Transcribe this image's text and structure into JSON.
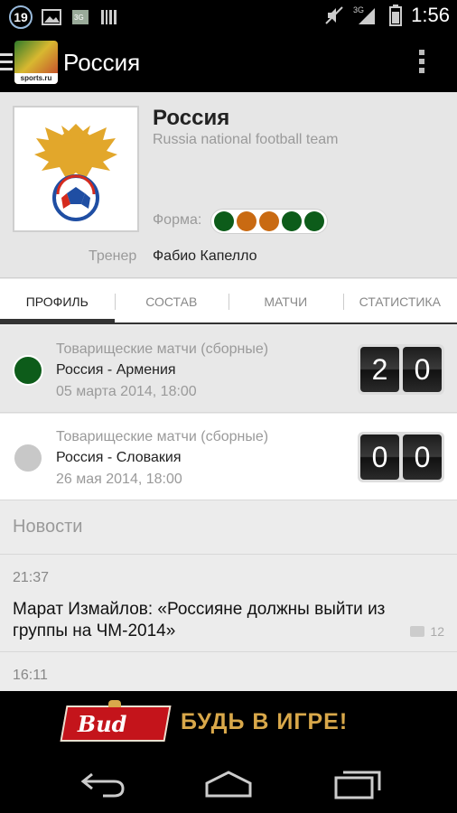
{
  "status_bar": {
    "notification_count": "19",
    "network": "3G",
    "time": "1:56"
  },
  "action_bar": {
    "app_logo_caption": "sports.ru",
    "title": "Россия"
  },
  "team": {
    "name": "Россия",
    "subtitle": "Russia national football team",
    "form_label": "Форма:",
    "form": [
      "win",
      "draw",
      "draw",
      "win",
      "win"
    ],
    "form_colors": {
      "win": "#0d5c1a",
      "draw": "#c96a12"
    },
    "coach_label": "Тренер",
    "coach_name": "Фабио Капелло"
  },
  "tabs": [
    {
      "label": "ПРОФИЛЬ",
      "active": true
    },
    {
      "label": "СОСТАВ",
      "active": false
    },
    {
      "label": "МАТЧИ",
      "active": false
    },
    {
      "label": "СТАТИСТИКА",
      "active": false
    }
  ],
  "matches": [
    {
      "tournament": "Товарищеские матчи (сборные)",
      "teams": "Россия - Армения",
      "date": "05 марта 2014, 18:00",
      "score_home": "2",
      "score_away": "0",
      "result_color": "#0d5c1a"
    },
    {
      "tournament": "Товарищеские матчи (сборные)",
      "teams": "Россия - Словакия",
      "date": "26 мая 2014, 18:00",
      "score_home": "0",
      "score_away": "0",
      "result_color": "#c8c8c8"
    }
  ],
  "news": {
    "heading": "Новости",
    "items": [
      {
        "time": "21:37",
        "title": "Марат Измайлов: «Россияне должны выйти из группы на ЧМ-2014»",
        "comments": "12"
      },
      {
        "time": "16:11",
        "title": "",
        "comments": ""
      }
    ]
  },
  "banner": {
    "brand": "Bud",
    "slogan": "БУДЬ В ИГРЕ!"
  }
}
